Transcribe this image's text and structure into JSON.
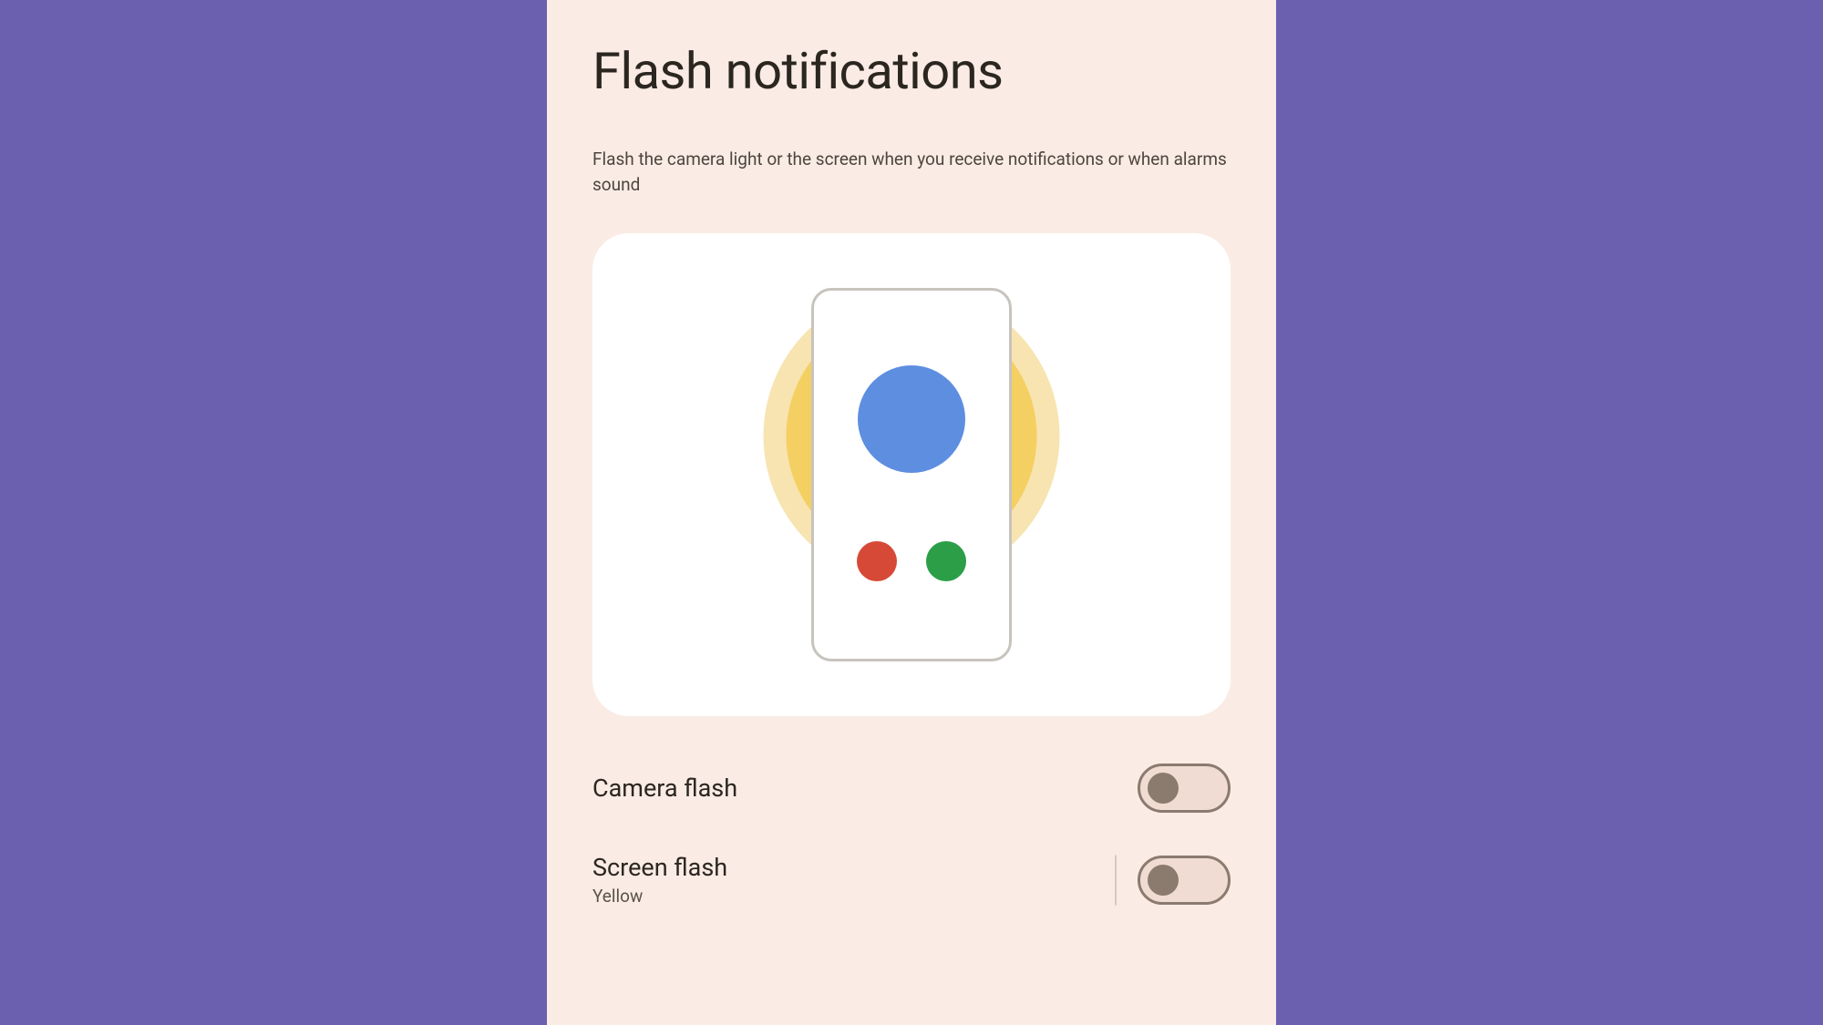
{
  "page": {
    "title": "Flash notifications",
    "description": "Flash the camera light or the screen when you receive notifications or when alarms sound"
  },
  "settings": {
    "camera_flash": {
      "label": "Camera flash",
      "enabled": false
    },
    "screen_flash": {
      "label": "Screen flash",
      "sublabel": "Yellow",
      "enabled": false
    }
  }
}
